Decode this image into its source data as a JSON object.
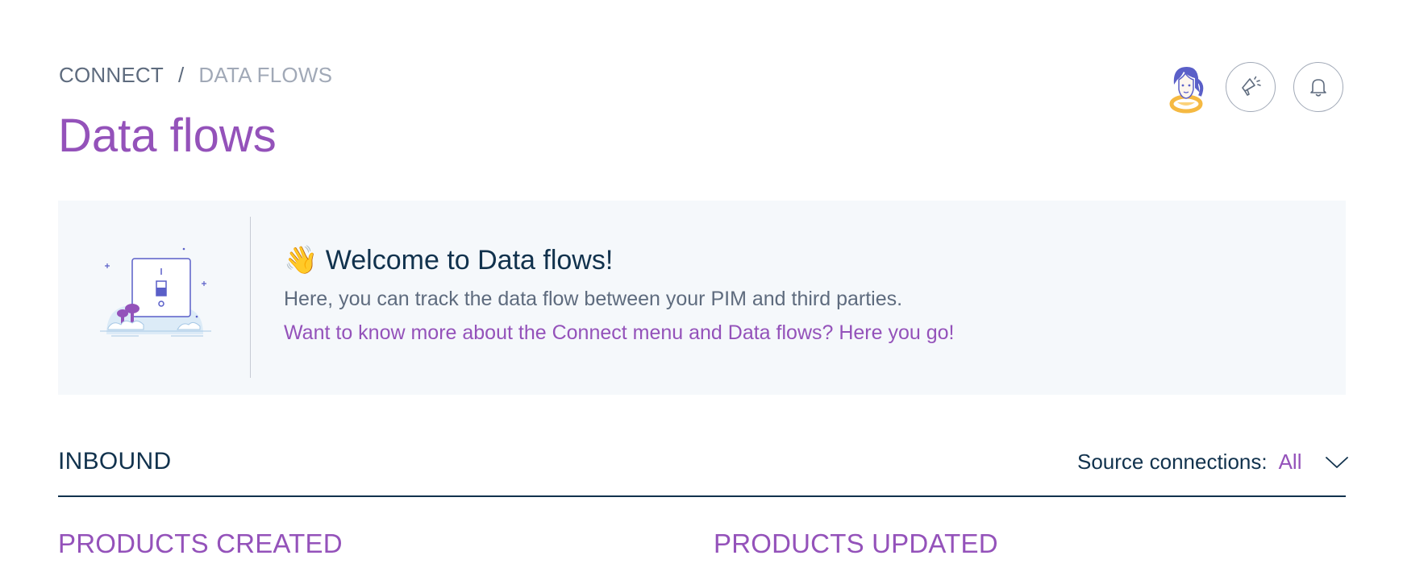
{
  "breadcrumb": {
    "root": "CONNECT",
    "separator": "/",
    "current": "DATA FLOWS"
  },
  "page": {
    "title": "Data flows"
  },
  "header_actions": {
    "avatar": "user-avatar",
    "announcements_icon": "megaphone-icon",
    "notifications_icon": "bell-icon"
  },
  "banner": {
    "illustration": "light-switch-illustration",
    "emoji": "👋",
    "title": "Welcome to Data flows!",
    "text": "Here, you can track the data flow between your PIM and third parties.",
    "link": "Want to know more about the Connect menu and Data flows? Here you go!"
  },
  "inbound": {
    "title": "INBOUND",
    "filter_label": "Source connections:",
    "filter_value": "All",
    "columns": [
      "PRODUCTS CREATED",
      "PRODUCTS UPDATED"
    ]
  },
  "colors": {
    "accent": "#9452ba",
    "text_dark": "#11324d",
    "text_muted": "#5e6b7e",
    "banner_bg": "#f5f8fb"
  }
}
